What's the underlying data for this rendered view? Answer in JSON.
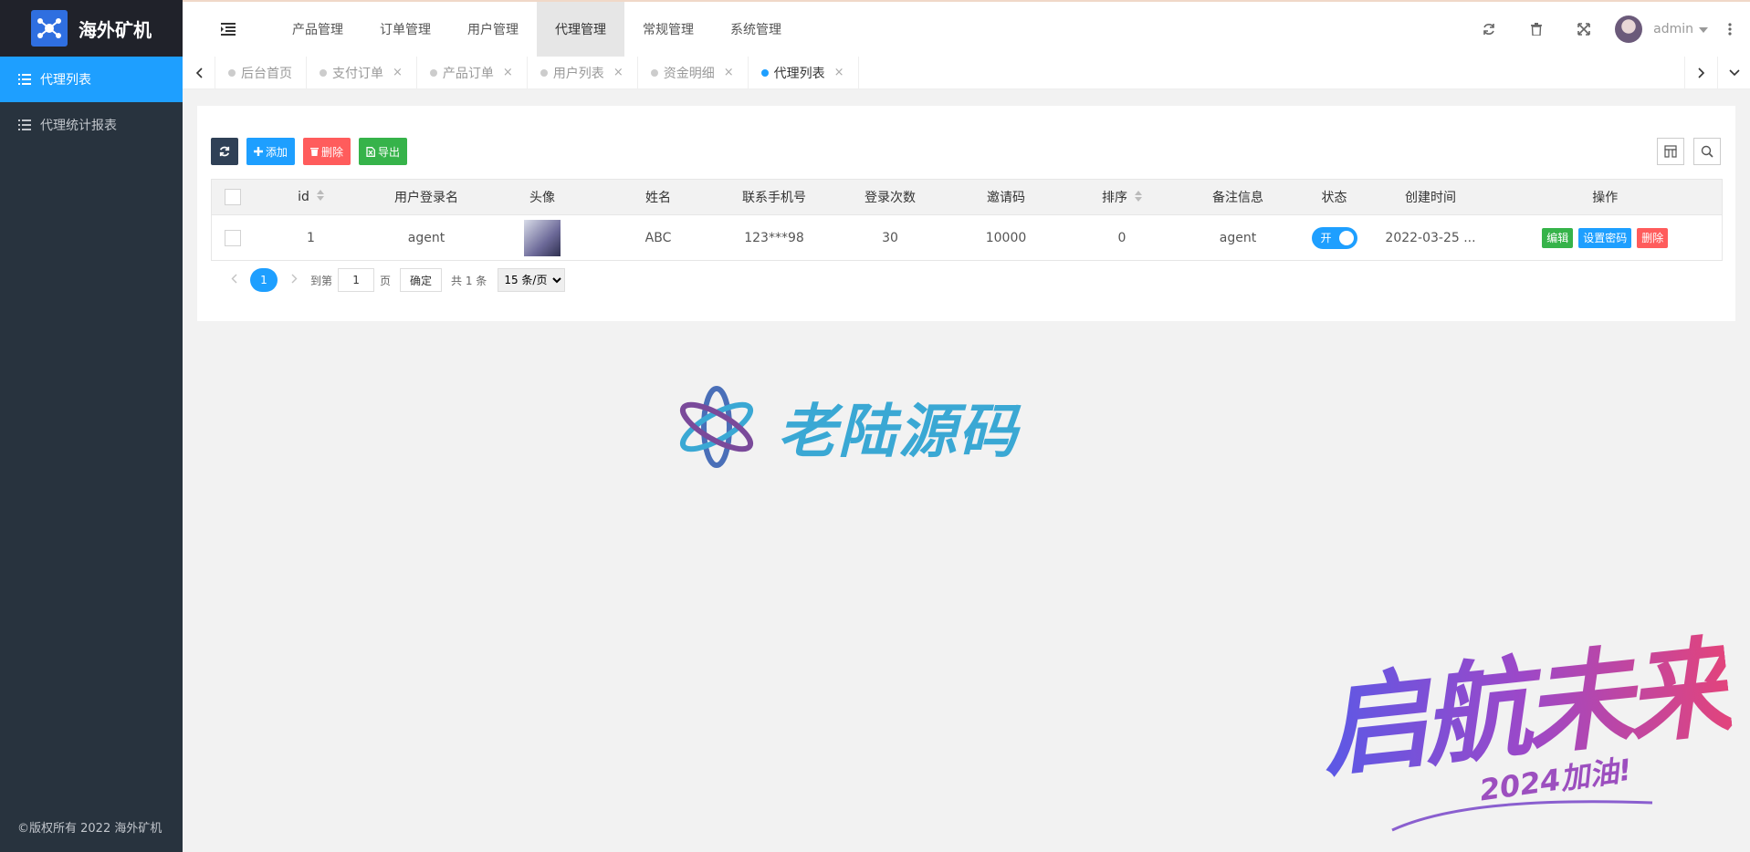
{
  "app": {
    "title": "海外矿机",
    "copyright": "©版权所有 2022 海外矿机"
  },
  "sidebar": {
    "items": [
      {
        "label": "代理列表"
      },
      {
        "label": "代理统计报表"
      }
    ]
  },
  "header": {
    "nav": [
      {
        "label": "产品管理"
      },
      {
        "label": "订单管理"
      },
      {
        "label": "用户管理"
      },
      {
        "label": "代理管理"
      },
      {
        "label": "常规管理"
      },
      {
        "label": "系统管理"
      }
    ],
    "user": "admin"
  },
  "tabs": [
    {
      "label": "后台首页"
    },
    {
      "label": "支付订单"
    },
    {
      "label": "产品订单"
    },
    {
      "label": "用户列表"
    },
    {
      "label": "资金明细"
    },
    {
      "label": "代理列表"
    }
  ],
  "toolbar": {
    "add": "添加",
    "del": "删除",
    "export": "导出"
  },
  "table": {
    "headers": {
      "id": "id",
      "login": "用户登录名",
      "avatar": "头像",
      "name": "姓名",
      "phone": "联系手机号",
      "logins": "登录次数",
      "invite": "邀请码",
      "sort": "排序",
      "remark": "备注信息",
      "status": "状态",
      "created": "创建时间",
      "ops": "操作"
    },
    "rows": [
      {
        "id": "1",
        "login": "agent",
        "name": "ABC",
        "phone": "123***98",
        "logins": "30",
        "invite": "10000",
        "sort": "0",
        "remark": "agent",
        "status": "开",
        "created": "2022-03-25 ..."
      }
    ],
    "actions": {
      "edit": "编辑",
      "pwd": "设置密码",
      "del": "删除"
    }
  },
  "pager": {
    "current": "1",
    "goto": "到第",
    "page_value": "1",
    "page_unit": "页",
    "confirm": "确定",
    "total": "共 1 条",
    "per_page": "15 条/页"
  },
  "watermarks": {
    "brand": "老陆源码",
    "slogan": "启航未来",
    "slogan_sub": "2024加油!"
  }
}
